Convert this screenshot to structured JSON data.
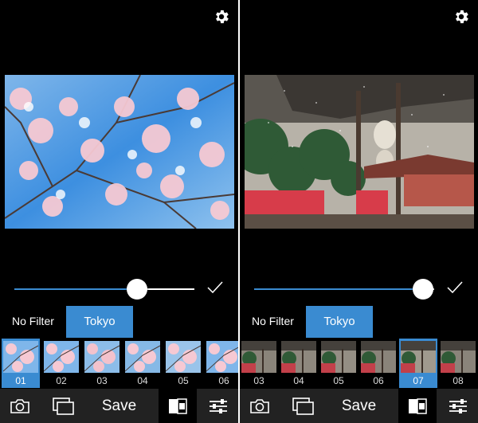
{
  "left": {
    "filter_none_label": "No Filter",
    "filter_active_label": "Tokyo",
    "slider_value": 0.68,
    "thumbnails": [
      "01",
      "02",
      "03",
      "04",
      "05",
      "06"
    ],
    "selected_thumbnail": "01",
    "toolbar": {
      "save_label": "Save"
    }
  },
  "right": {
    "filter_none_label": "No Filter",
    "filter_active_label": "Tokyo",
    "slider_value": 0.94,
    "thumbnails": [
      "03",
      "04",
      "05",
      "06",
      "07",
      "08"
    ],
    "selected_thumbnail": "07",
    "toolbar": {
      "save_label": "Save"
    }
  },
  "colors": {
    "accent": "#3a8bd1",
    "toolbar_bg": "#222222",
    "background": "#000000"
  },
  "icons": [
    "gear-icon",
    "check-icon",
    "camera-icon",
    "gallery-icon",
    "filter-compare-icon",
    "adjust-sliders-icon"
  ]
}
